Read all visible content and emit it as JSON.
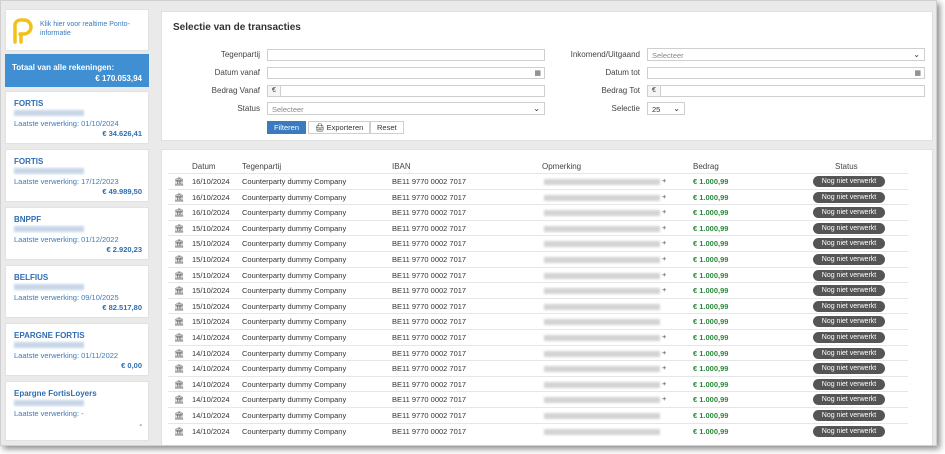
{
  "sidebar": {
    "ponto_link": "Klik hier voor realtime Ponto-informatie",
    "total": {
      "label": "Totaal van alle rekeningen:",
      "value": "€ 170.053,94"
    },
    "accounts": [
      {
        "name": "FORTIS",
        "last_processed": "Laatste verwerking: 01/10/2024",
        "balance": "€ 34.626,41"
      },
      {
        "name": "FORTIS",
        "last_processed": "Laatste verwerking: 17/12/2023",
        "balance": "€ 49.989,50"
      },
      {
        "name": "BNPPF",
        "last_processed": "Laatste verwerking: 01/12/2022",
        "balance": "€ 2.920,23"
      },
      {
        "name": "BELFIUS",
        "last_processed": "Laatste verwerking: 09/10/2025",
        "balance": "€ 82.517,80"
      },
      {
        "name": "EPARGNE FORTIS",
        "last_processed": "Laatste verwerking: 01/11/2022",
        "balance": "€ 0,00"
      },
      {
        "name": "Epargne FortisLoyers",
        "last_processed": "Laatste verwerking: -",
        "balance": "-"
      }
    ]
  },
  "filter": {
    "title": "Selectie van de transacties",
    "tegenpartij_label": "Tegenpartij",
    "datum_vanaf_label": "Datum vanaf",
    "bedrag_vanaf_label": "Bedrag Vanaf",
    "status_label": "Status",
    "status_placeholder": "Selecteer",
    "inout_label": "Inkomend/Uitgaand",
    "inout_placeholder": "Selecteer",
    "datum_tot_label": "Datum tot",
    "bedrag_tot_label": "Bedrag Tot",
    "selectie_label": "Selectie",
    "selectie_value": "25",
    "euro_symbol": "€",
    "buttons": {
      "filter": "Filteren",
      "export": "Exporteren",
      "reset": "Reset"
    }
  },
  "table": {
    "headers": {
      "datum": "Datum",
      "tegenpartij": "Tegenpartij",
      "iban": "IBAN",
      "opmerking": "Opmerking",
      "bedrag": "Bedrag",
      "status": "Status"
    },
    "rows": [
      {
        "date": "16/10/2024",
        "counterparty": "Counterparty dummy Company",
        "iban": "BE11 9770 0002 7017",
        "remark_suffix": "+",
        "amount": "€ 1.000,99",
        "status": "Nog niet verwerkt"
      },
      {
        "date": "16/10/2024",
        "counterparty": "Counterparty dummy Company",
        "iban": "BE11 9770 0002 7017",
        "remark_suffix": "+",
        "amount": "€ 1.000,99",
        "status": "Nog niet verwerkt"
      },
      {
        "date": "16/10/2024",
        "counterparty": "Counterparty dummy Company",
        "iban": "BE11 9770 0002 7017",
        "remark_suffix": "+",
        "amount": "€ 1.000,99",
        "status": "Nog niet verwerkt"
      },
      {
        "date": "15/10/2024",
        "counterparty": "Counterparty dummy Company",
        "iban": "BE11 9770 0002 7017",
        "remark_suffix": "+",
        "amount": "€ 1.000,99",
        "status": "Nog niet verwerkt"
      },
      {
        "date": "15/10/2024",
        "counterparty": "Counterparty dummy Company",
        "iban": "BE11 9770 0002 7017",
        "remark_suffix": "+",
        "amount": "€ 1.000,99",
        "status": "Nog niet verwerkt"
      },
      {
        "date": "15/10/2024",
        "counterparty": "Counterparty dummy Company",
        "iban": "BE11 9770 0002 7017",
        "remark_suffix": "+",
        "amount": "€ 1.000,99",
        "status": "Nog niet verwerkt"
      },
      {
        "date": "15/10/2024",
        "counterparty": "Counterparty dummy Company",
        "iban": "BE11 9770 0002 7017",
        "remark_suffix": "+",
        "amount": "€ 1.000,99",
        "status": "Nog niet verwerkt"
      },
      {
        "date": "15/10/2024",
        "counterparty": "Counterparty dummy Company",
        "iban": "BE11 9770 0002 7017",
        "remark_suffix": "+",
        "amount": "€ 1.000,99",
        "status": "Nog niet verwerkt"
      },
      {
        "date": "15/10/2024",
        "counterparty": "Counterparty dummy Company",
        "iban": "BE11 9770 0002 7017",
        "remark_suffix": "",
        "amount": "€ 1.000,99",
        "status": "Nog niet verwerkt"
      },
      {
        "date": "15/10/2024",
        "counterparty": "Counterparty dummy Company",
        "iban": "BE11 9770 0002 7017",
        "remark_suffix": "",
        "amount": "€ 1.000,99",
        "status": "Nog niet verwerkt"
      },
      {
        "date": "14/10/2024",
        "counterparty": "Counterparty dummy Company",
        "iban": "BE11 9770 0002 7017",
        "remark_suffix": "+",
        "amount": "€ 1.000,99",
        "status": "Nog niet verwerkt"
      },
      {
        "date": "14/10/2024",
        "counterparty": "Counterparty dummy Company",
        "iban": "BE11 9770 0002 7017",
        "remark_suffix": "+",
        "amount": "€ 1.000,99",
        "status": "Nog niet verwerkt"
      },
      {
        "date": "14/10/2024",
        "counterparty": "Counterparty dummy Company",
        "iban": "BE11 9770 0002 7017",
        "remark_suffix": "+",
        "amount": "€ 1.000,99",
        "status": "Nog niet verwerkt"
      },
      {
        "date": "14/10/2024",
        "counterparty": "Counterparty dummy Company",
        "iban": "BE11 9770 0002 7017",
        "remark_suffix": "+",
        "amount": "€ 1.000,99",
        "status": "Nog niet verwerkt"
      },
      {
        "date": "14/10/2024",
        "counterparty": "Counterparty dummy Company",
        "iban": "BE11 9770 0002 7017",
        "remark_suffix": "+",
        "amount": "€ 1.000,99",
        "status": "Nog niet verwerkt"
      },
      {
        "date": "14/10/2024",
        "counterparty": "Counterparty dummy Company",
        "iban": "BE11 9770 0002 7017",
        "remark_suffix": "",
        "amount": "€ 1.000,99",
        "status": "Nog niet verwerkt"
      },
      {
        "date": "14/10/2024",
        "counterparty": "Counterparty dummy Company",
        "iban": "BE11 9770 0002 7017",
        "remark_suffix": "",
        "amount": "€ 1.000,99",
        "status": "Nog niet verwerkt"
      }
    ]
  },
  "colors": {
    "accent": "#3f8fd2",
    "amount_green": "#2a8a3a",
    "badge": "#555555"
  }
}
